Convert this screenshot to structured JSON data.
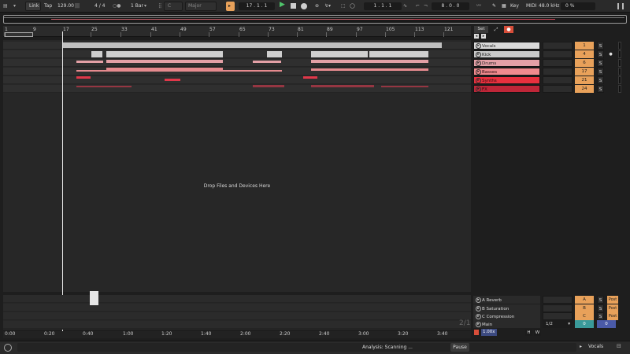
{
  "transport": {
    "link": "Link",
    "tap": "Tap",
    "tempo": "129.00",
    "signature": "4 / 4",
    "quantize": "1 Bar",
    "key": "C",
    "scale": "Major",
    "position": "17 .  1 .  1",
    "loop_start": "1 .  1 .  1",
    "loop_length": "8 .  0 .  0",
    "key_map": "Key",
    "midi_map": "MIDI",
    "sample_rate": "48.0 kHz",
    "cpu": "0 %"
  },
  "ruler": {
    "bars": [
      "1",
      "9",
      "17",
      "25",
      "33",
      "41",
      "49",
      "57",
      "65",
      "73",
      "81",
      "89",
      "97",
      "105",
      "113",
      "121"
    ]
  },
  "arrangement": {
    "drop_hint": "Drop Files and Devices Here",
    "page_indicator": "2/1"
  },
  "mixer": {
    "set_label": "Set",
    "tracks": [
      {
        "name": "Vocals",
        "number": "1",
        "solo": "S",
        "color": "#d9d9d9",
        "num_color": "#e8a15a"
      },
      {
        "name": "Kick",
        "number": "4",
        "solo": "S",
        "color": "#c9c9c9",
        "num_color": "#e8a15a"
      },
      {
        "name": "Drums",
        "number": "6",
        "solo": "S",
        "color": "#e3a0a6",
        "num_color": "#e8a15a"
      },
      {
        "name": "Basses",
        "number": "17",
        "solo": "S",
        "color": "#f08a8e",
        "num_color": "#e8a15a"
      },
      {
        "name": "Synths",
        "number": "21",
        "solo": "S",
        "color": "#e8303e",
        "num_color": "#e8a15a"
      },
      {
        "name": "FX",
        "number": "24",
        "solo": "S",
        "color": "#bf2638",
        "num_color": "#e8a15a"
      }
    ],
    "returns": [
      {
        "name": "A Reverb",
        "letter": "A",
        "solo": "S",
        "mode": "Post"
      },
      {
        "name": "B Saturation",
        "letter": "B",
        "solo": "S",
        "mode": "Post"
      },
      {
        "name": "C Compression",
        "letter": "C",
        "solo": "S",
        "mode": "Post"
      }
    ],
    "main": {
      "name": "Main",
      "output": "1/2",
      "left_value": "0",
      "right_value": "0"
    },
    "zoom": "1.00x",
    "h_label": "H",
    "w_label": "W"
  },
  "timeline": {
    "labels": [
      "0:00",
      "0:20",
      "0:40",
      "1:00",
      "1:20",
      "1:40",
      "2:00",
      "2:20",
      "2:40",
      "3:00",
      "3:20",
      "3:40"
    ]
  },
  "status": {
    "analysis": "Analysis: Scanning ...",
    "pause": "Pause",
    "selected_track": "Vocals"
  },
  "colors": {
    "accent_orange": "#e8a15a",
    "play_green": "#4fc46b",
    "bass_clip": "#e58a8e",
    "synth_clip": "#e0384a",
    "fx_clip": "#b83a4a"
  }
}
